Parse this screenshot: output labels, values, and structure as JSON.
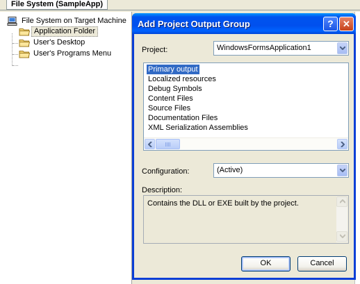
{
  "ide": {
    "tab_title": "File System (SampleApp)",
    "tree": {
      "root": "File System on Target Machine",
      "items": [
        "Application Folder",
        "User's Desktop",
        "User's Programs Menu"
      ]
    }
  },
  "dialog": {
    "title": "Add Project Output Group",
    "help_glyph": "?",
    "close_glyph": "✕",
    "project_label": "Project:",
    "project_value": "WindowsFormsApplication1",
    "outputs": [
      "Primary output",
      "Localized resources",
      "Debug Symbols",
      "Content Files",
      "Source Files",
      "Documentation Files",
      "XML Serialization Assemblies"
    ],
    "selected_output": "Primary output",
    "configuration_label": "Configuration:",
    "configuration_value": "(Active)",
    "description_label": "Description:",
    "description_text": "Contains the DLL or EXE built by the project.",
    "ok_label": "OK",
    "cancel_label": "Cancel"
  },
  "icons": {
    "computer": "computer-icon",
    "folder": "folder-icon",
    "dropdown": "chevron-down-icon",
    "help": "help-icon",
    "close": "close-icon"
  },
  "colors": {
    "titlebar": "#0053ee",
    "selection": "#316ac5",
    "dialog_face": "#ece9d8"
  }
}
